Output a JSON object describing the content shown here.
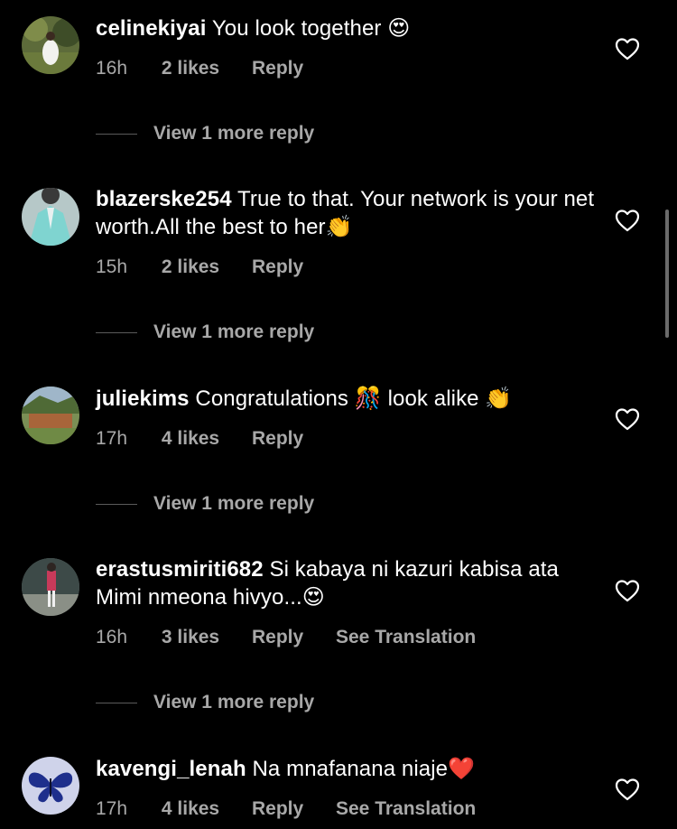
{
  "comments": [
    {
      "username": "celinekiyai",
      "text": "You look together",
      "emoji": "😍",
      "time": "16h",
      "likes": "2 likes",
      "reply": "Reply",
      "view_more": "View 1 more reply"
    },
    {
      "username": "blazerske254",
      "text": "True to that. Your network is your net worth.All the best to her",
      "emoji": "👏",
      "time": "15h",
      "likes": "2 likes",
      "reply": "Reply",
      "view_more": "View 1 more reply"
    },
    {
      "username": "juliekims",
      "text_before": "Congratulations",
      "emoji_mid": "🎊",
      "text_after": "look alike",
      "emoji": "👏",
      "time": "17h",
      "likes": "4 likes",
      "reply": "Reply",
      "view_more": "View 1 more reply"
    },
    {
      "username": "erastusmiriti682",
      "text": "Si kabaya ni kazuri kabisa ata Mimi nmeona hivyo...",
      "emoji": "😍",
      "time": "16h",
      "likes": "3 likes",
      "reply": "Reply",
      "see_translation": "See Translation",
      "view_more": "View 1 more reply"
    },
    {
      "username": "kavengi_lenah",
      "text": "Na mnafanana niaje",
      "emoji": "❤️",
      "time": "17h",
      "likes": "4 likes",
      "reply": "Reply",
      "see_translation": "See Translation"
    }
  ],
  "colors": {
    "background": "#000000",
    "text": "#ffffff",
    "secondary": "#a8a8a8"
  },
  "icons": [
    "heart-outline-icon",
    "avatar"
  ]
}
